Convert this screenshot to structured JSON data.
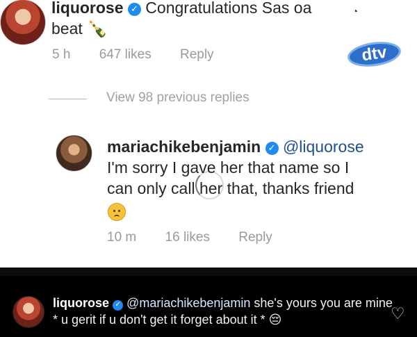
{
  "comment_1": {
    "user": "liquorose",
    "text_line_1": "Congratulations Sas o",
    "text_line_1_tail": "a",
    "text_line_2": "beat",
    "time": "5 h",
    "likes": "647 likes",
    "reply": "Reply"
  },
  "view_replies": "View 98 previous replies",
  "logo_text": "dtv",
  "comment_2": {
    "user": "mariachikebenjamin",
    "mention": "@liquorose",
    "line_1": "I'm sorry I gave her that name so I",
    "line_2": "can only call her that, thanks friend",
    "time": "10 m",
    "likes": "16 likes",
    "reply": "Reply"
  },
  "comment_3": {
    "user": "liquorose",
    "mention": "@mariachikebenjamin",
    "text": " she's yours you are mine * u gerit if u don't get it forget about it *"
  },
  "icons": {
    "verified": "verified-badge-icon",
    "bottle": "bottle-icon",
    "heart": "heart-icon",
    "emoji": "sad-face-icon"
  },
  "colors": {
    "accent": "#1f8bf0",
    "meta": "#9a9a9a",
    "dark_background": "#000000"
  }
}
